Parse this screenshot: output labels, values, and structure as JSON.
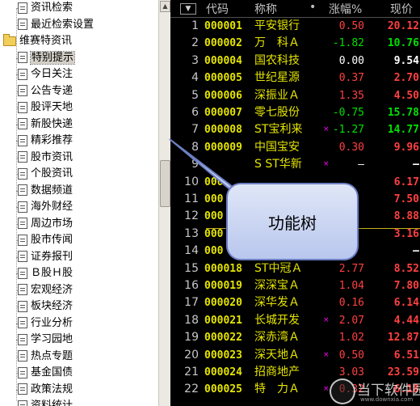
{
  "tree": {
    "items": [
      {
        "label": "资讯检索",
        "kind": "doc"
      },
      {
        "label": "最近检索设置",
        "kind": "doc"
      },
      {
        "label": "维赛特资讯",
        "kind": "folder"
      },
      {
        "label": "特别提示",
        "kind": "doc",
        "selected": true
      },
      {
        "label": "今日关注",
        "kind": "doc"
      },
      {
        "label": "公告专递",
        "kind": "doc"
      },
      {
        "label": "股评天地",
        "kind": "doc"
      },
      {
        "label": "新股快递",
        "kind": "doc"
      },
      {
        "label": "精彩推荐",
        "kind": "doc"
      },
      {
        "label": "股市资讯",
        "kind": "doc"
      },
      {
        "label": "个股资讯",
        "kind": "doc"
      },
      {
        "label": "数据频道",
        "kind": "doc"
      },
      {
        "label": "海外财经",
        "kind": "doc"
      },
      {
        "label": "周边市场",
        "kind": "doc"
      },
      {
        "label": "股市传闻",
        "kind": "doc"
      },
      {
        "label": "证券报刊",
        "kind": "doc"
      },
      {
        "label": "Ｂ股Ｈ股",
        "kind": "doc"
      },
      {
        "label": "宏观经济",
        "kind": "doc"
      },
      {
        "label": "板块经济",
        "kind": "doc"
      },
      {
        "label": "行业分析",
        "kind": "doc"
      },
      {
        "label": "学习园地",
        "kind": "doc"
      },
      {
        "label": "热点专题",
        "kind": "doc"
      },
      {
        "label": "基金国债",
        "kind": "doc"
      },
      {
        "label": "政策法规",
        "kind": "doc"
      },
      {
        "label": "资料统计",
        "kind": "doc"
      }
    ]
  },
  "grid": {
    "headers": {
      "menu": "▼",
      "code": "代码",
      "name": "称称",
      "dot": "•",
      "change_pct": "涨幅%",
      "price": "现价"
    },
    "rows": [
      {
        "idx": "1",
        "code": "000001",
        "name": "平安银行",
        "mark": "",
        "pct": "0.50",
        "price": "20.12",
        "dir": "up"
      },
      {
        "idx": "2",
        "code": "000002",
        "name": "万　科Ａ",
        "mark": "",
        "pct": "-1.82",
        "price": "10.76",
        "dir": "down"
      },
      {
        "idx": "3",
        "code": "000004",
        "name": "国农科技",
        "mark": "",
        "pct": "0.00",
        "price": "9.54",
        "dir": "flat"
      },
      {
        "idx": "4",
        "code": "000005",
        "name": "世纪星源",
        "mark": "",
        "pct": "0.37",
        "price": "2.70",
        "dir": "up"
      },
      {
        "idx": "5",
        "code": "000006",
        "name": "深振业Ａ",
        "mark": "",
        "pct": "1.35",
        "price": "4.50",
        "dir": "up"
      },
      {
        "idx": "6",
        "code": "000007",
        "name": "零七股份",
        "mark": "",
        "pct": "-0.75",
        "price": "15.78",
        "dir": "down"
      },
      {
        "idx": "7",
        "code": "000008",
        "name": "ST宝利来",
        "mark": "×",
        "pct": "-1.27",
        "price": "14.77",
        "dir": "down"
      },
      {
        "idx": "8",
        "code": "000009",
        "name": "中国宝安",
        "mark": "",
        "pct": "0.30",
        "price": "9.96",
        "dir": "up"
      },
      {
        "idx": "9",
        "code": "",
        "name": "S ST华新",
        "mark": "×",
        "pct": "—",
        "price": "—",
        "dir": "flat"
      },
      {
        "idx": "10",
        "code": "000",
        "name": "",
        "mark": "",
        "pct": "",
        "price": "6.17",
        "dir": "up"
      },
      {
        "idx": "11",
        "code": "000",
        "name": "",
        "mark": "",
        "pct": "",
        "price": "7.50",
        "dir": "up"
      },
      {
        "idx": "12",
        "code": "000",
        "name": "",
        "mark": "",
        "pct": "",
        "price": "8.88",
        "dir": "up"
      },
      {
        "idx": "13",
        "code": "000",
        "name": "",
        "mark": "",
        "pct": "",
        "price": "3.16",
        "dir": "up"
      },
      {
        "idx": "14",
        "code": "000",
        "name": "",
        "mark": "",
        "pct": "",
        "price": "—",
        "dir": "flat"
      },
      {
        "idx": "15",
        "code": "000018",
        "name": "ST中冠Ａ",
        "mark": "",
        "pct": "2.77",
        "price": "8.52",
        "dir": "up"
      },
      {
        "idx": "16",
        "code": "000019",
        "name": "深深宝Ａ",
        "mark": "",
        "pct": "1.04",
        "price": "7.80",
        "dir": "up"
      },
      {
        "idx": "17",
        "code": "000020",
        "name": "深华发Ａ",
        "mark": "",
        "pct": "0.16",
        "price": "6.14",
        "dir": "up"
      },
      {
        "idx": "18",
        "code": "000021",
        "name": "长城开发",
        "mark": "×",
        "pct": "2.07",
        "price": "4.44",
        "dir": "up"
      },
      {
        "idx": "19",
        "code": "000022",
        "name": "深赤湾Ａ",
        "mark": "",
        "pct": "1.02",
        "price": "12.87",
        "dir": "up"
      },
      {
        "idx": "20",
        "code": "000023",
        "name": "深天地Ａ",
        "mark": "×",
        "pct": "0.50",
        "price": "6.51",
        "dir": "up"
      },
      {
        "idx": "21",
        "code": "000024",
        "name": "招商地产",
        "mark": "",
        "pct": "3.03",
        "price": "23.59",
        "dir": "up"
      },
      {
        "idx": "22",
        "code": "000025",
        "name": "特　力Ａ",
        "mark": "×",
        "pct": "0.32",
        "price": "6.18",
        "dir": "up"
      }
    ]
  },
  "callout": {
    "text": "功能树"
  },
  "watermark": {
    "text": "当下软件园",
    "url": "www.downxia.com"
  }
}
